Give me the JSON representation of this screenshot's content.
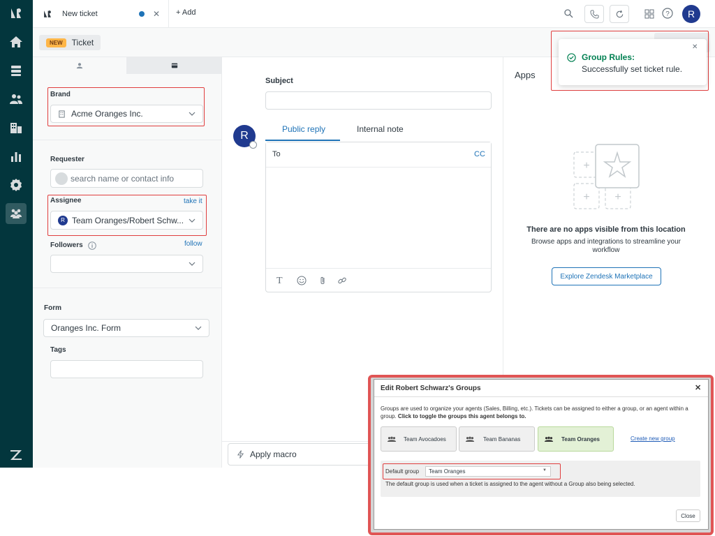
{
  "topbar": {
    "tab_title": "New ticket",
    "add_label": "Add",
    "avatar_letter": "R"
  },
  "subheader": {
    "new_badge": "NEW",
    "ticket_label": "Ticket"
  },
  "left_panel": {
    "brand_label": "Brand",
    "brand_value": "Acme Oranges Inc.",
    "requester_label": "Requester",
    "requester_placeholder": "search name or contact info",
    "assignee_label": "Assignee",
    "take_it": "take it",
    "assignee_avatar": "R",
    "assignee_value": "Team Oranges/Robert Schw...",
    "followers_label": "Followers",
    "follow": "follow",
    "form_label": "Form",
    "form_value": "Oranges Inc. Form",
    "tags_label": "Tags"
  },
  "center": {
    "subject_label": "Subject",
    "avatar_letter": "R",
    "tabs": [
      "Public reply",
      "Internal note"
    ],
    "to_label": "To",
    "cc_label": "CC",
    "apply_macro": "Apply macro"
  },
  "apps": {
    "title": "Apps",
    "empty_title": "There are no apps visible from this location",
    "empty_desc": "Browse apps and integrations to streamline your workflow",
    "marketplace_button": "Explore Zendesk Marketplace"
  },
  "toast": {
    "title": "Group Rules:",
    "message": "Successfully set ticket rule."
  },
  "modal": {
    "title": "Edit Robert Schwarz's Groups",
    "intro": "Groups are used to organize your agents (Sales, Billing, etc.). Tickets can be assigned to either a group, or an agent within a group.",
    "intro_bold": "Click to toggle the groups this agent belongs to.",
    "groups": [
      {
        "label": "Team Avocadoes",
        "selected": false
      },
      {
        "label": "Team Bananas",
        "selected": false
      },
      {
        "label": "Team Oranges",
        "selected": true
      }
    ],
    "create_link": "Create new group",
    "default_group_label": "Default group",
    "default_group_value": "Team Oranges",
    "default_group_help": "The default group is used when a ticket is assigned to the agent without a Group also being selected.",
    "close_button": "Close"
  },
  "colors": {
    "nav_bg": "#03363d",
    "accent": "#1f73b7",
    "success": "#038153",
    "selected_group": "#e3f1d6",
    "annotation_red": "#e03e3e"
  }
}
